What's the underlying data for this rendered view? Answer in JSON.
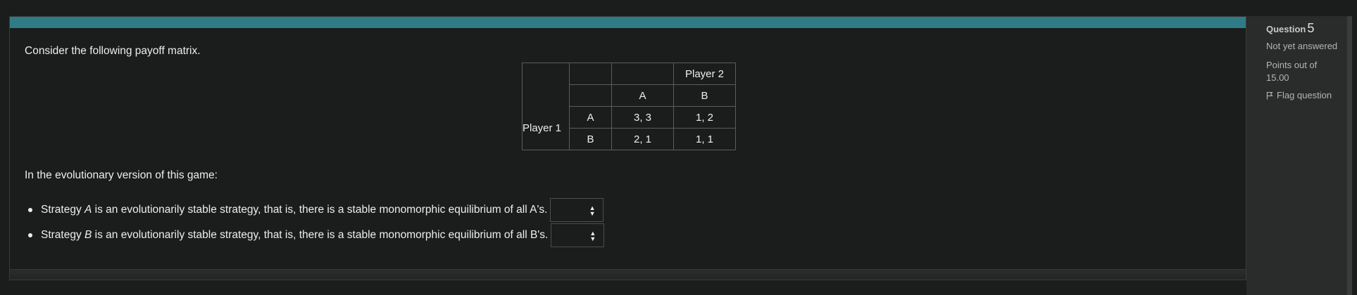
{
  "question": {
    "intro": "Consider the following payoff matrix.",
    "matrix": {
      "player2_label": "Player 2",
      "player1_label": "Player 1",
      "col_headers": [
        "A",
        "B"
      ],
      "rows": [
        {
          "label": "A",
          "cells": [
            "3, 3",
            "1, 2"
          ]
        },
        {
          "label": "B",
          "cells": [
            "2, 1",
            "1, 1"
          ]
        }
      ]
    },
    "evo_intro": "In the evolutionary version of this game:",
    "statements": [
      {
        "pre": "Strategy ",
        "strategy": "A",
        "post": " is an evolutionarily stable strategy, that is, there is a stable monomorphic equilibrium of all A's.",
        "selected": ""
      },
      {
        "pre": "Strategy ",
        "strategy": "B",
        "post": " is an evolutionarily stable strategy, that is, there is a stable monomorphic equilibrium of all B's.",
        "selected": ""
      }
    ],
    "accent_color": "#2f7b86"
  },
  "info": {
    "question_label": "Question",
    "question_number": "5",
    "status": "Not yet answered",
    "points": "Points out of 15.00",
    "flag_label": "Flag question"
  }
}
